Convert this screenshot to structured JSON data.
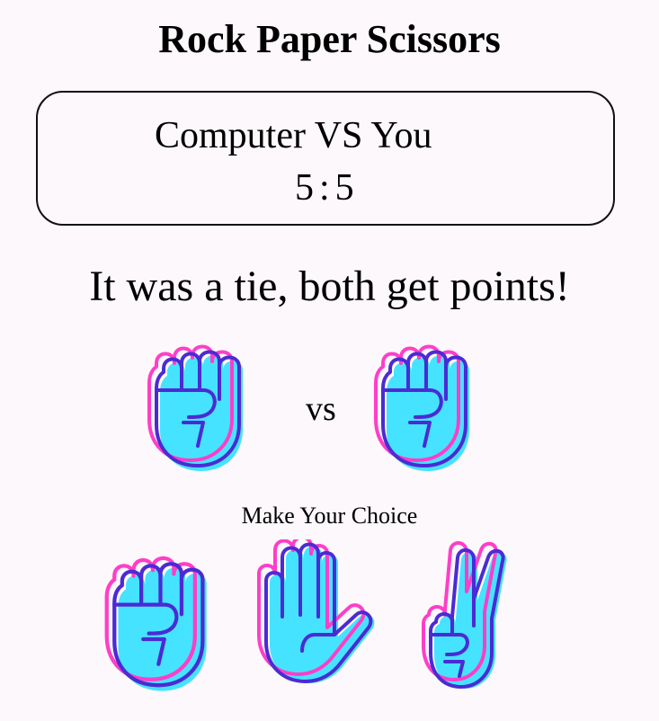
{
  "title": "Rock Paper Scissors",
  "scoreboard": {
    "heading": "Computer VS You",
    "computer_score": "5",
    "separator": ":",
    "player_score": "5"
  },
  "result_message": "It was a tie, both get points!",
  "round": {
    "computer_pick": "rock",
    "player_pick": "rock",
    "vs_label": "vs"
  },
  "choices": {
    "prompt": "Make Your Choice",
    "options": [
      "rock",
      "paper",
      "scissors"
    ]
  },
  "colors": {
    "hand_fill": "#45e3ff",
    "hand_outline": "#4b2bd4",
    "hand_offset_outline": "#ff3ec8",
    "hand_shadow": "#45e3ff"
  }
}
